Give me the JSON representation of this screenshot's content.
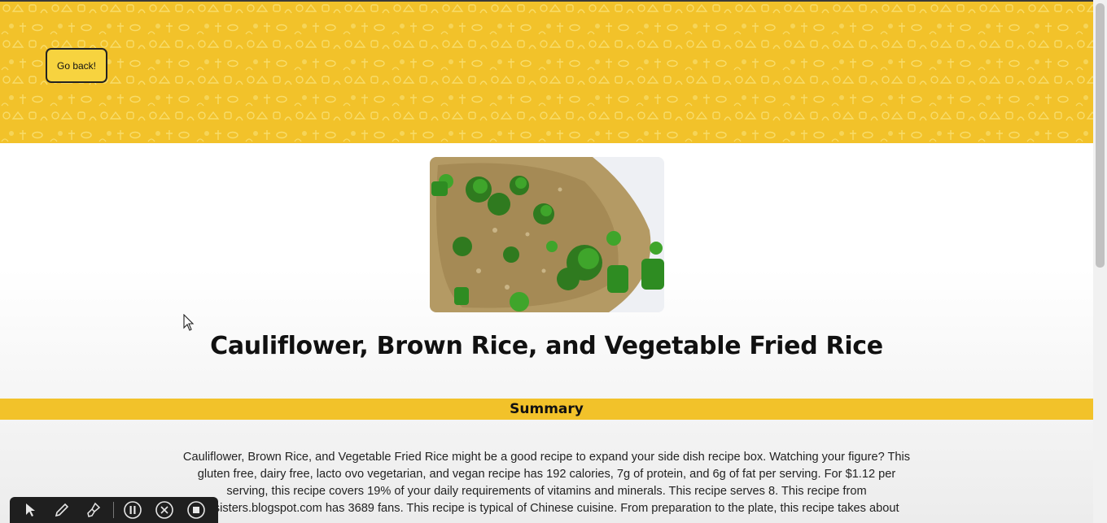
{
  "header": {
    "back_button_label": "Go back!"
  },
  "recipe": {
    "image_alt": "fried rice with green beans and broccoli",
    "title": "Cauliflower, Brown Rice, and Vegetable Fried Rice"
  },
  "summary": {
    "heading": "Summary",
    "lines": [
      "Cauliflower, Brown Rice, and Vegetable Fried Rice might be a good recipe to expand your side dish recipe box. Watching your figure? This",
      "gluten free, dairy free, lacto ovo vegetarian, and vegan recipe has 192 calories, 7g of protein, and 6g of fat per serving. For $1.12 per",
      "serving, this recipe covers 19% of your daily requirements of vitamins and minerals. This recipe serves 8. This recipe from",
      "bensisters.blogspot.com has 3689 fans. This recipe is typical of Chinese cuisine. From preparation to the plate, this recipe takes about"
    ]
  },
  "colors": {
    "accent_yellow": "#f2c22a",
    "button_yellow": "#f7d33f",
    "text_dark": "#111111"
  },
  "recorder_toolbar": {
    "icons": [
      "pointer-icon",
      "pen-icon",
      "brush-icon",
      "pause-icon",
      "cancel-icon",
      "stop-icon"
    ]
  }
}
